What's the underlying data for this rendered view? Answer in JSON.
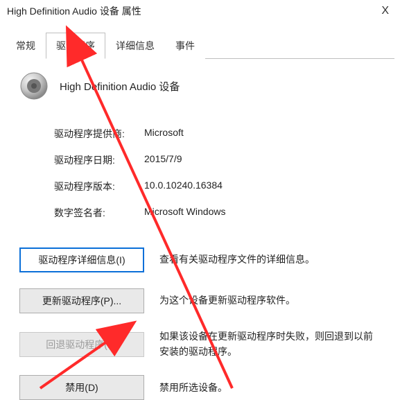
{
  "window": {
    "title": "High Definition Audio 设备 属性",
    "close": "X"
  },
  "tabs": {
    "general": "常规",
    "driver": "驱动程序",
    "details": "详细信息",
    "events": "事件"
  },
  "device": {
    "name": "High Definition Audio 设备",
    "icon": "speaker-icon"
  },
  "info": {
    "provider_label": "驱动程序提供商:",
    "provider_value": "Microsoft",
    "date_label": "驱动程序日期:",
    "date_value": "2015/7/9",
    "version_label": "驱动程序版本:",
    "version_value": "10.0.10240.16384",
    "signer_label": "数字签名者:",
    "signer_value": "Microsoft Windows"
  },
  "actions": {
    "details_btn": "驱动程序详细信息(I)",
    "details_desc": "查看有关驱动程序文件的详细信息。",
    "update_btn": "更新驱动程序(P)...",
    "update_desc": "为这个设备更新驱动程序软件。",
    "rollback_btn": "回退驱动程序(R)",
    "rollback_desc": "如果该设备在更新驱动程序时失败，则回退到以前安装的驱动程序。",
    "disable_btn": "禁用(D)",
    "disable_desc": "禁用所选设备。"
  },
  "colors": {
    "arrow": "#ff2a2a",
    "highlight_border": "#0a6fd8"
  }
}
